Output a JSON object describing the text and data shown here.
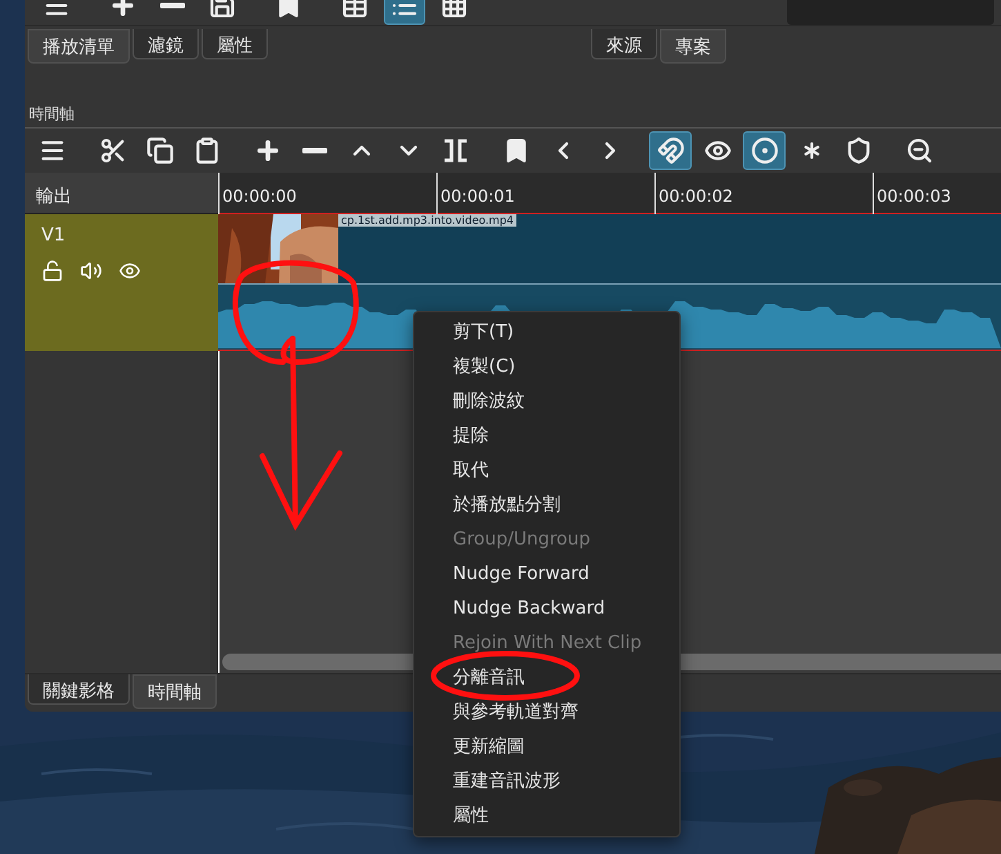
{
  "top_toolbar": [
    {
      "kind": "menu",
      "on": false
    },
    {
      "kind": "plus",
      "on": false
    },
    {
      "kind": "minus",
      "on": false
    },
    {
      "kind": "update",
      "on": false
    },
    {
      "kind": "marker",
      "on": false
    },
    {
      "kind": "details",
      "on": false
    },
    {
      "kind": "list",
      "on": true
    },
    {
      "kind": "grid",
      "on": false
    }
  ],
  "left_tabs": [
    {
      "label": "播放清單",
      "selected": true
    },
    {
      "label": "濾鏡",
      "selected": false
    },
    {
      "label": "屬性",
      "selected": false
    }
  ],
  "right_tabs": [
    {
      "label": "來源",
      "selected": false
    },
    {
      "label": "專案",
      "selected": true
    }
  ],
  "timeline": {
    "title": "時間軸",
    "toolbar": [
      {
        "kind": "menu",
        "on": false
      },
      {
        "kind": "cut",
        "on": false
      },
      {
        "kind": "copy",
        "on": false
      },
      {
        "kind": "paste",
        "on": false
      },
      {
        "kind": "plus",
        "on": false
      },
      {
        "kind": "minus",
        "on": false
      },
      {
        "kind": "up",
        "on": false
      },
      {
        "kind": "down",
        "on": false
      },
      {
        "kind": "split",
        "on": false
      },
      {
        "kind": "marker",
        "on": false
      },
      {
        "kind": "prev",
        "on": false
      },
      {
        "kind": "next",
        "on": false
      },
      {
        "kind": "snap",
        "on": true
      },
      {
        "kind": "scrub",
        "on": false
      },
      {
        "kind": "ripple",
        "on": true
      },
      {
        "kind": "ripple_all",
        "on": false
      },
      {
        "kind": "ripple_markers",
        "on": false
      },
      {
        "kind": "zoom_out",
        "on": false
      }
    ],
    "output_label": "輸出",
    "ruler": [
      "00:00:00",
      "00:00:01",
      "00:00:02",
      "00:00:03"
    ],
    "track": {
      "name": "V1",
      "clip_name": "cp.1st.add.mp3.into.video.mp4"
    }
  },
  "context_menu": [
    {
      "label": "剪下(T)",
      "disabled": false
    },
    {
      "label": "複製(C)",
      "disabled": false
    },
    {
      "label": "刪除波紋",
      "disabled": false
    },
    {
      "label": "提除",
      "disabled": false
    },
    {
      "label": "取代",
      "disabled": false
    },
    {
      "label": "於播放點分割",
      "disabled": false
    },
    {
      "label": "Group/Ungroup",
      "disabled": true
    },
    {
      "label": "Nudge Forward",
      "disabled": false
    },
    {
      "label": "Nudge Backward",
      "disabled": false
    },
    {
      "label": "Rejoin With Next Clip",
      "disabled": true
    },
    {
      "label": "分離音訊",
      "disabled": false
    },
    {
      "label": "與參考軌道對齊",
      "disabled": false
    },
    {
      "label": "更新縮圖",
      "disabled": false
    },
    {
      "label": "重建音訊波形",
      "disabled": false
    },
    {
      "label": "屬性",
      "disabled": false
    }
  ],
  "bottom_tabs": [
    {
      "label": "關鍵影格",
      "selected": false
    },
    {
      "label": "時間軸",
      "selected": true
    }
  ]
}
